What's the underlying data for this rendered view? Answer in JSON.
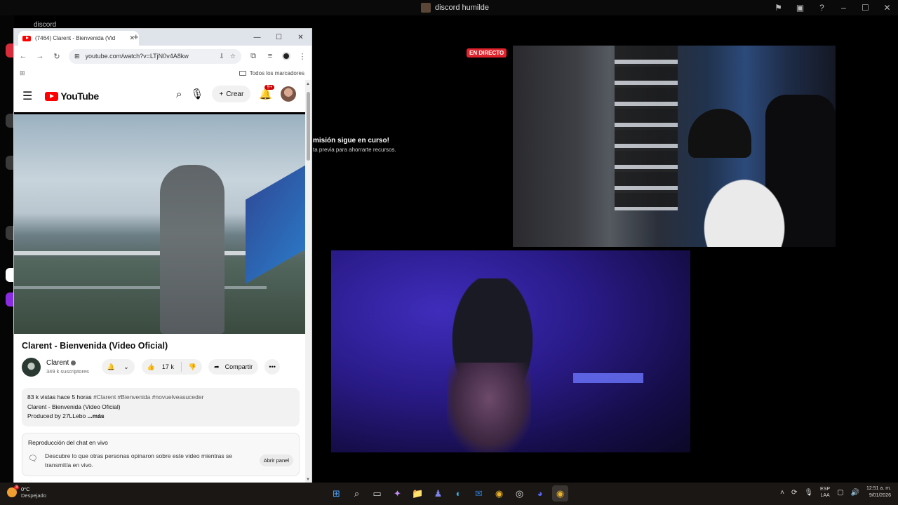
{
  "discord": {
    "window_title": "discord humilde",
    "sidebar_tab": "discord",
    "live_badge": "EN DIRECTO",
    "notice_line1": "misión sigue en curso!",
    "notice_line2": "ta previa para ahorrarte recursos."
  },
  "chrome": {
    "tab_title": "(7464) Clarent - Bienvenida (Vid",
    "url": "youtube.com/watch?v=LTjN0v4A8kw",
    "bookmarks_label": "Todos los marcadores"
  },
  "youtube": {
    "logo_text": "YouTube",
    "create_label": "Crear",
    "notif_count": "9+",
    "video_title": "Clarent - Bienvenida (Video Oficial)",
    "channel_name": "Clarent",
    "subscribers": "349 k suscriptores",
    "likes": "17 k",
    "share_label": "Compartir",
    "desc_views": "83 k vistas",
    "desc_time": "hace 5 horas",
    "desc_tags": "#Clarent #Bienvenida #novuelveasuceder",
    "desc_line2": "Clarent - Bienvenida (Video Oficial)",
    "desc_line3": "Produced by 27LLebo",
    "desc_more": "...más",
    "chat_heading": "Reproducción del chat en vivo",
    "chat_text": "Descubre lo que otras personas opinaron sobre este video mientras se transmitía en vivo.",
    "chat_button": "Abrir panel"
  },
  "taskbar": {
    "weather_badge": "3",
    "temperature": "0°C",
    "condition": "Despejado",
    "lang_top": "ESP",
    "lang_bottom": "LAA",
    "time": "12:51 a. m.",
    "date": "9/01/2026"
  },
  "colors": {
    "live_red": "#e0242d",
    "youtube_red": "#ff0000",
    "taskbar_bg": "#1a1714"
  }
}
